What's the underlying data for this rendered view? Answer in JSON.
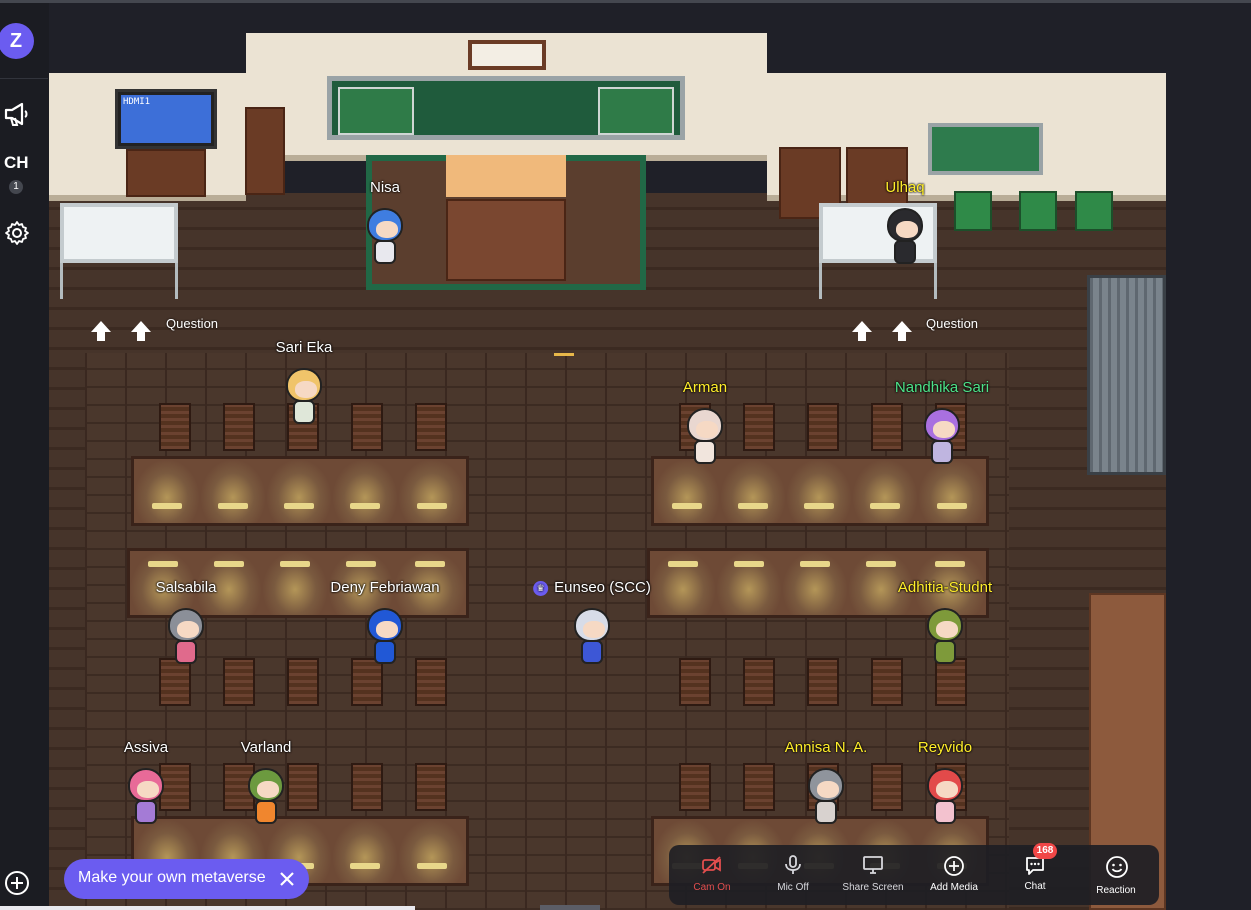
{
  "sidebar": {
    "logo_letter": "Z",
    "channel_label": "CH",
    "channel_number": "1",
    "icons": [
      "megaphone-icon",
      "settings-icon",
      "add-icon"
    ]
  },
  "room": {
    "tv_text": "HDMI1",
    "question_label_left": "Question",
    "question_label_right": "Question"
  },
  "players": [
    {
      "name": "Nisa",
      "color": "white",
      "hood": "#3f7de0",
      "body": "#e8e8ee"
    },
    {
      "name": "Ulhaq",
      "color": "yellow",
      "hood": "#2a2a2e",
      "body": "#2a2a2e"
    },
    {
      "name": "Sari Eka",
      "color": "white",
      "hood": "#f0c46a",
      "body": "#dfe7d9"
    },
    {
      "name": "Arman",
      "color": "yellow",
      "hood": "#e9d7d0",
      "body": "#f1e5dd"
    },
    {
      "name": "Nandhika Sari",
      "color": "green",
      "hood": "#a970e0",
      "body": "#bfb5e0"
    },
    {
      "name": "Salsabila",
      "color": "white",
      "hood": "#8b8f98",
      "body": "#e06a8c"
    },
    {
      "name": "Deny Febriawan",
      "color": "white",
      "hood": "#2158d6",
      "body": "#2158d6"
    },
    {
      "name": "Eunseo (SCC)",
      "color": "white",
      "hood": "#d7dce8",
      "body": "#3d57d6",
      "crown": "♛"
    },
    {
      "name": "Adhitia-Studnt",
      "color": "yellow",
      "hood": "#7e9a3a",
      "body": "#7e9a3a"
    },
    {
      "name": "Assiva",
      "color": "white",
      "hood": "#e86a98",
      "body": "#a47bd6"
    },
    {
      "name": "Varland",
      "color": "white",
      "hood": "#6c9a3f",
      "body": "#f0862e"
    },
    {
      "name": "Annisa N. A.",
      "color": "yellow",
      "hood": "#8f949c",
      "body": "#d8d2cf"
    },
    {
      "name": "Reyvido",
      "color": "yellow",
      "hood": "#e24a4a",
      "body": "#f3c2cf"
    }
  ],
  "toolbar": {
    "cam": {
      "label": "Cam On",
      "icon": "camera-off-icon"
    },
    "mic": {
      "label": "Mic Off",
      "icon": "microphone-icon"
    },
    "share": {
      "label": "Share Screen",
      "icon": "monitor-icon"
    },
    "media": {
      "label": "Add Media",
      "icon": "plus-circle-icon"
    },
    "chat": {
      "label": "Chat",
      "icon": "chat-icon",
      "badge": "168"
    },
    "reaction": {
      "label": "Reaction",
      "icon": "smiley-icon"
    }
  },
  "promo": {
    "text": "Make your own metaverse",
    "close_icon": "close-icon"
  }
}
